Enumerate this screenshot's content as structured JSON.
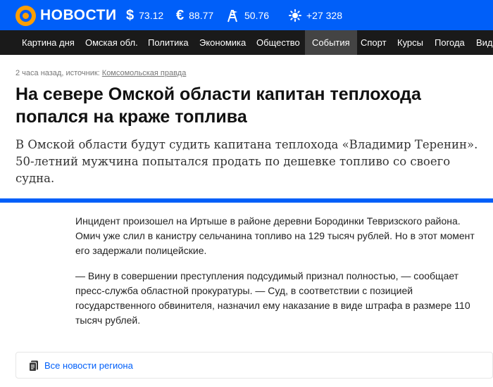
{
  "brand": {
    "name": "НОВОСТИ",
    "accent": "#005ff9",
    "logo_color": "#ff9e00"
  },
  "tickers": {
    "usd": {
      "icon": "dollar-icon",
      "symbol": "$",
      "value": "73.12"
    },
    "eur": {
      "icon": "euro-icon",
      "symbol": "€",
      "value": "88.77"
    },
    "oil": {
      "icon": "oil-rig-icon",
      "value": "50.76"
    },
    "weather": {
      "icon": "sun-icon",
      "value": "+27 328"
    }
  },
  "nav": {
    "items": [
      "Картина дня",
      "Омская обл.",
      "Политика",
      "Экономика",
      "Общество",
      "События",
      "Спорт",
      "Курсы",
      "Погода",
      "Вид"
    ],
    "active": "События"
  },
  "article": {
    "meta_prefix": "2 часа назад, источник: ",
    "source": "Комсомольская правда",
    "title": "На севере Омской области капитан теплохода попался на краже топлива",
    "lead": "В Омской области будут судить капитана теплохода «Владимир Теренин». 50-летний мужчина попытался продать по дешевке топливо со своего судна.",
    "paragraphs": [
      "Инцидент произошел на Иртыше в районе деревни Бородинки Тевризского района. Омич уже слил в канистру сельчанина топливо на 129 тысяч рублей. Но в этот момент его задержали полицейские.",
      "— Вину в совершении преступления подсудимый признал полностью, — сообщает пресс-служба областной прокуратуры. — Суд, в соответствии с позицией государственного обвинителя, назначил ему наказание в виде штрафа в размере 110 тысяч рублей."
    ]
  },
  "region_link": {
    "icon": "news-icon",
    "label": "Все новости региона"
  }
}
